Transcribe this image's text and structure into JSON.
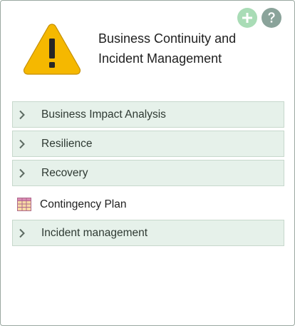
{
  "header": {
    "title_line1": "Business Continuity and",
    "title_line2": "Incident Management",
    "add_icon": "plus-circle-icon",
    "help_icon": "question-circle-icon",
    "warning_icon": "warning-triangle-icon"
  },
  "items": [
    {
      "label": "Business Impact Analysis",
      "type": "expandable"
    },
    {
      "label": "Resilience",
      "type": "expandable"
    },
    {
      "label": "Recovery",
      "type": "expandable"
    },
    {
      "label": "Contingency Plan",
      "type": "document"
    },
    {
      "label": "Incident management",
      "type": "expandable"
    }
  ],
  "colors": {
    "row_bg": "#e6f1ea",
    "row_border": "#c7d8cc",
    "warning": "#f5b800",
    "add": "#a9dcb6",
    "help": "#8aa39a"
  }
}
